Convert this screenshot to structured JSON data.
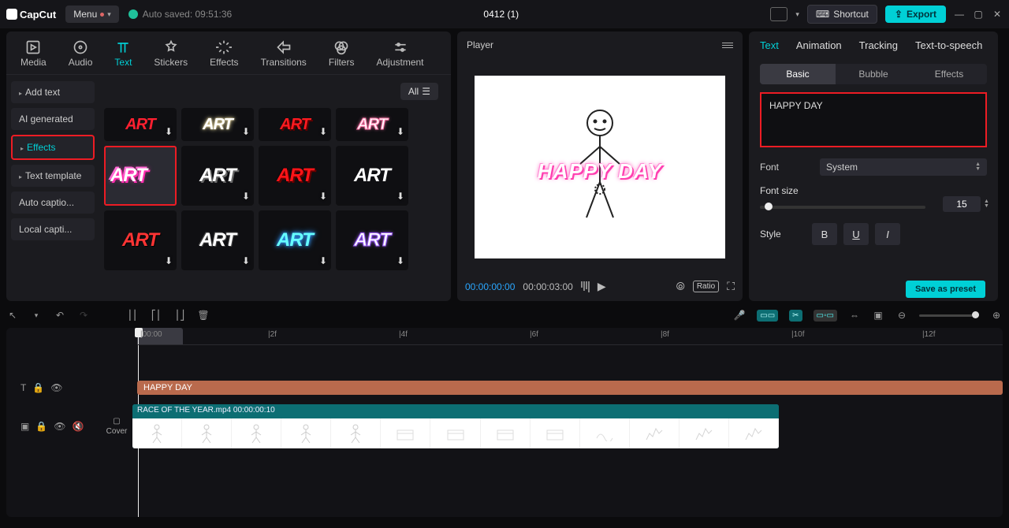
{
  "titlebar": {
    "logo": "CapCut",
    "menu": "Menu",
    "autosave": "Auto saved: 09:51:36",
    "project": "0412 (1)",
    "shortcut": "Shortcut",
    "export": "Export"
  },
  "media_tabs": [
    "Media",
    "Audio",
    "Text",
    "Stickers",
    "Effects",
    "Transitions",
    "Filters",
    "Adjustment"
  ],
  "media_active": "Text",
  "text_side": {
    "items": [
      "Add text",
      "AI generated",
      "Effects",
      "Text template",
      "Auto captio...",
      "Local capti..."
    ],
    "highlighted": "Effects"
  },
  "grid": {
    "all_label": "All",
    "download_glyph": "⬇",
    "tile_text": "ART"
  },
  "player": {
    "title": "Player",
    "overlay_text": "HAPPY DAY",
    "current": "00:00:00:00",
    "total": "00:00:03:00",
    "ratio_label": "Ratio"
  },
  "inspector": {
    "tabs": [
      "Text",
      "Animation",
      "Tracking",
      "Text-to-speech"
    ],
    "subtabs": [
      "Basic",
      "Bubble",
      "Effects"
    ],
    "text_value": "HAPPY DAY",
    "font_label": "Font",
    "font_value": "System",
    "fontsize_label": "Font size",
    "fontsize_value": "15",
    "style_label": "Style",
    "style_buttons": [
      "B",
      "U",
      "I"
    ],
    "save_preset": "Save as preset"
  },
  "timeline": {
    "ruler": [
      "|00:00",
      "|2f",
      "|4f",
      "|6f",
      "|8f",
      "|10f",
      "|12f"
    ],
    "text_clip": "HAPPY DAY",
    "video_clip": "RACE OF THE YEAR.mp4   00:00:00:10",
    "cover": "Cover"
  }
}
